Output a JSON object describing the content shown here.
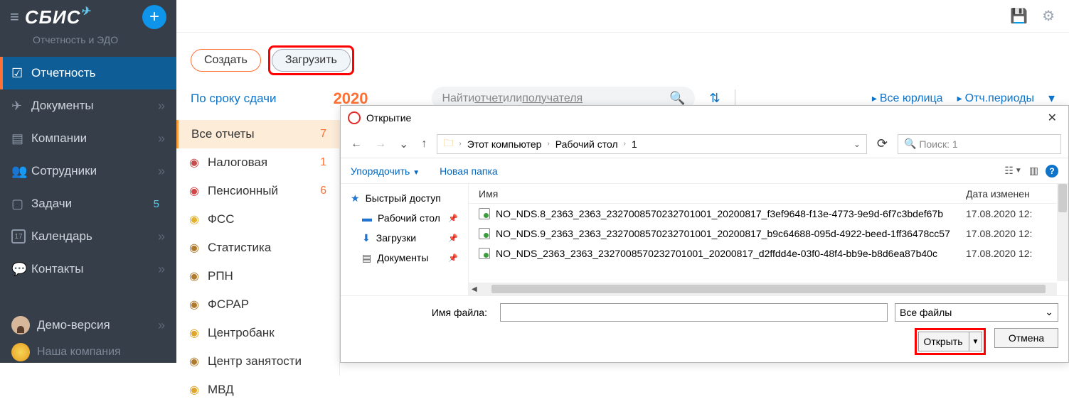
{
  "sidebar": {
    "logo": "СБИС",
    "subtitle": "Отчетность и ЭДО",
    "items": [
      {
        "label": "Отчетность",
        "active": true
      },
      {
        "label": "Документы"
      },
      {
        "label": "Компании"
      },
      {
        "label": "Сотрудники"
      },
      {
        "label": "Задачи",
        "badge": "5"
      },
      {
        "label": "Календарь",
        "cal": "17"
      },
      {
        "label": "Контакты"
      }
    ],
    "demo": "Демо-версия",
    "company": "Наша компания"
  },
  "top": {
    "create": "Создать",
    "upload": "Загрузить"
  },
  "filter": {
    "by_deadline": "По сроку сдачи",
    "year": "2020",
    "search_prefix": "Найти ",
    "search_l1": "отчет",
    "search_mid": " или ",
    "search_l2": "получателя",
    "all_legal": "Все юрлица",
    "periods": "Отч.периоды"
  },
  "categories": [
    {
      "label": "Все отчеты",
      "count": "7",
      "sel": true
    },
    {
      "label": "Налоговая",
      "count": "1",
      "ico_color": "#c84b4b"
    },
    {
      "label": "Пенсионный",
      "count": "6",
      "ico_color": "#d14545"
    },
    {
      "label": "ФСС",
      "ico_color": "#e6b12e"
    },
    {
      "label": "Статистика",
      "ico_color": "#b07a2c"
    },
    {
      "label": "РПН",
      "ico_color": "#b07a2c"
    },
    {
      "label": "ФСРАР",
      "ico_color": "#b07a2c"
    },
    {
      "label": "Центробанк",
      "ico_color": "#e0a52a"
    },
    {
      "label": "Центр занятости",
      "ico_color": "#b07a2c"
    },
    {
      "label": "МВД",
      "ico_color": "#e0a52a"
    }
  ],
  "dialog": {
    "title": "Открытие",
    "path": [
      "Этот компьютер",
      "Рабочий стол",
      "1"
    ],
    "search_placeholder": "Поиск: 1",
    "organize": "Упорядочить",
    "new_folder": "Новая папка",
    "tree": [
      {
        "label": "Быстрый доступ",
        "ico": "★",
        "color": "#1e74d0"
      },
      {
        "label": "Рабочий стол",
        "ico": "▬",
        "color": "#1e74d0",
        "pin": true
      },
      {
        "label": "Загрузки",
        "ico": "⬇",
        "color": "#1e74d0",
        "pin": true
      },
      {
        "label": "Документы",
        "ico": "▤",
        "color": "#555",
        "pin": true
      }
    ],
    "col_name": "Имя",
    "col_date": "Дата изменен",
    "files": [
      {
        "name": "NO_NDS.8_2363_2363_2327008570232701001_20200817_f3ef9648-f13e-4773-9e9d-6f7c3bdef67b",
        "date": "17.08.2020 12:"
      },
      {
        "name": "NO_NDS.9_2363_2363_2327008570232701001_20200817_b9c64688-095d-4922-beed-1ff36478cc57",
        "date": "17.08.2020 12:"
      },
      {
        "name": "NO_NDS_2363_2363_2327008570232701001_20200817_d2ffdd4e-03f0-48f4-bb9e-b8d6ea87b40c",
        "date": "17.08.2020 12:"
      }
    ],
    "filename_label": "Имя файла:",
    "filetype": "Все файлы",
    "open": "Открыть",
    "cancel": "Отмена"
  }
}
